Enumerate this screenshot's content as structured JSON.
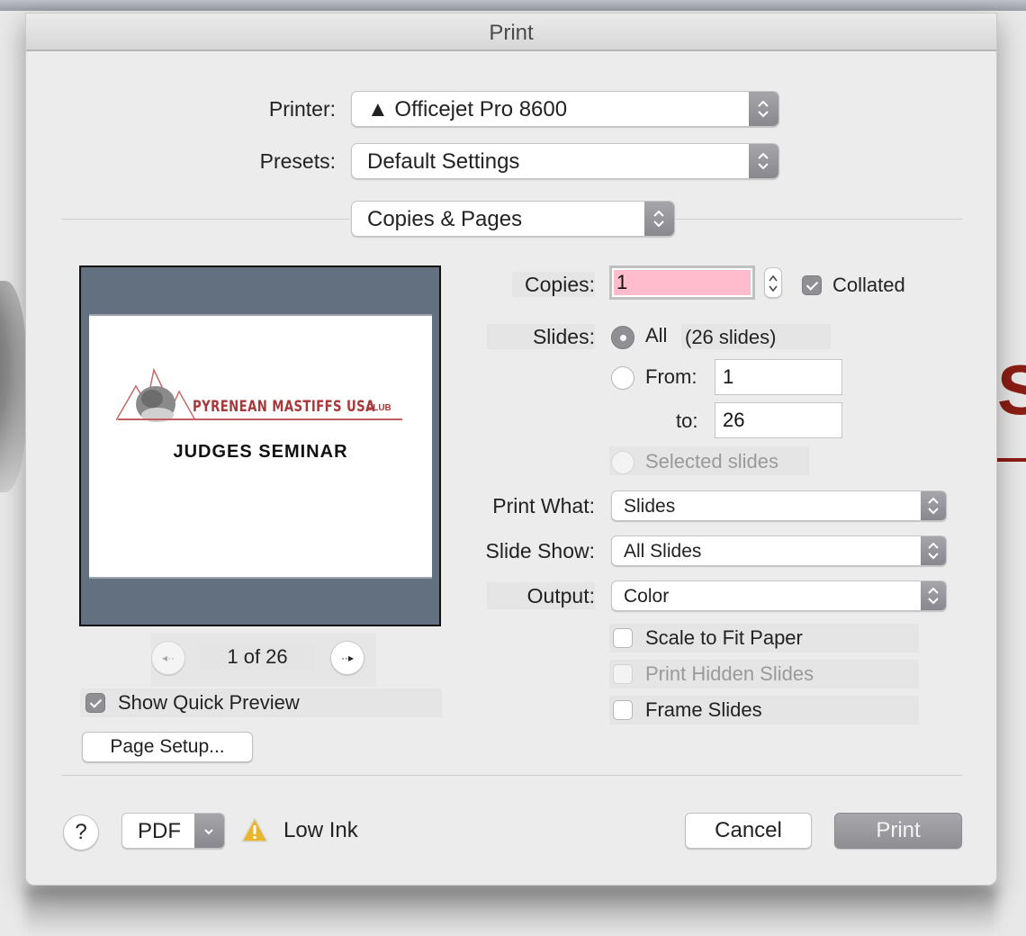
{
  "window": {
    "title": "Print"
  },
  "printer": {
    "label": "Printer:",
    "value": "▲ Officejet Pro 8600"
  },
  "presets": {
    "label": "Presets:",
    "value": "Default Settings"
  },
  "section_popup": {
    "value": "Copies & Pages"
  },
  "preview": {
    "slide": {
      "logo_text": "PYRENEAN MASTIFFS USA",
      "logo_club": "CLUB",
      "title": "JUDGES SEMINAR"
    },
    "page_counter": "1 of 26",
    "prev_icon": "arrow-left-icon",
    "next_icon": "arrow-right-icon",
    "show_quick_preview": {
      "label": "Show Quick Preview",
      "checked": true
    },
    "page_setup_label": "Page Setup..."
  },
  "copies": {
    "label": "Copies:",
    "value": "1",
    "collated": {
      "label": "Collated",
      "checked": true
    }
  },
  "slides": {
    "label": "Slides:",
    "all_label": "All",
    "all_count": "(26 slides)",
    "from_label": "From:",
    "from_value": "1",
    "to_label": "to:",
    "to_value": "26",
    "selected_label": "Selected slides",
    "selected_option": "All"
  },
  "print_what": {
    "label": "Print What:",
    "value": "Slides"
  },
  "slide_show": {
    "label": "Slide Show:",
    "value": "All Slides"
  },
  "output": {
    "label": "Output:",
    "value": "Color"
  },
  "options": [
    {
      "label": "Scale to Fit Paper",
      "checked": false,
      "enabled": true
    },
    {
      "label": "Print Hidden Slides",
      "checked": false,
      "enabled": false
    },
    {
      "label": "Frame Slides",
      "checked": false,
      "enabled": true
    }
  ],
  "footer": {
    "help_label": "?",
    "pdf_label": "PDF",
    "warning_icon": "warning-triangle-icon",
    "status": "Low Ink",
    "cancel_label": "Cancel",
    "print_label": "Print"
  },
  "colors": {
    "copies_field_bg": "#ffbccc",
    "preview_bg": "#637080",
    "logo_red": "#a8383a",
    "default_button": "#8e8e93"
  }
}
